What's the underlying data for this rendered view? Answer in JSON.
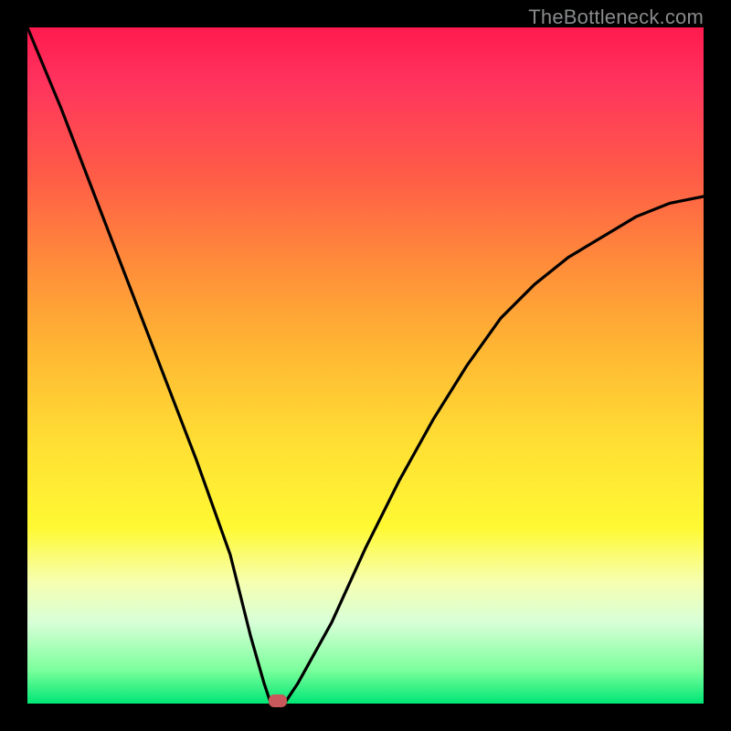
{
  "watermark": "TheBottleneck.com",
  "chart_data": {
    "type": "line",
    "title": "",
    "xlabel": "",
    "ylabel": "",
    "xlim": [
      0,
      100
    ],
    "ylim": [
      0,
      100
    ],
    "series": [
      {
        "name": "bottleneck-curve",
        "x": [
          0,
          5,
          10,
          15,
          20,
          25,
          30,
          33,
          35,
          36,
          38,
          40,
          45,
          50,
          55,
          60,
          65,
          70,
          75,
          80,
          85,
          90,
          95,
          100
        ],
        "values": [
          100,
          88,
          75,
          62,
          49,
          36,
          22,
          10,
          3,
          0,
          0,
          3,
          12,
          23,
          33,
          42,
          50,
          57,
          62,
          66,
          69,
          72,
          74,
          75
        ]
      }
    ],
    "marker": {
      "x": 37,
      "y": 0,
      "color": "#c8585b"
    }
  }
}
